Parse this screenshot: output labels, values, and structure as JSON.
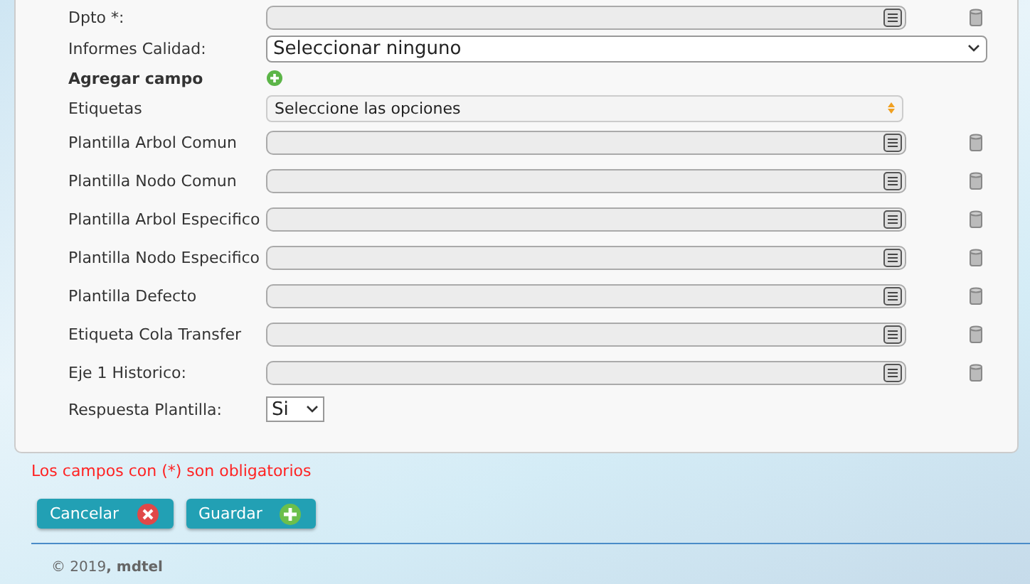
{
  "form": {
    "rows": [
      {
        "kind": "lookup",
        "label": "Dpto *:"
      },
      {
        "kind": "select",
        "label": "Informes Calidad:",
        "value": "Seleccionar ninguno"
      },
      {
        "kind": "add",
        "label": "Agregar campo"
      },
      {
        "kind": "multiselect",
        "label": "Etiquetas",
        "value": "Seleccione las opciones"
      },
      {
        "kind": "lookup",
        "label": "Plantilla Arbol Comun"
      },
      {
        "kind": "lookup",
        "label": "Plantilla Nodo Comun"
      },
      {
        "kind": "lookup",
        "label": "Plantilla Arbol Especifico"
      },
      {
        "kind": "lookup",
        "label": "Plantilla Nodo Especifico"
      },
      {
        "kind": "lookup",
        "label": "Plantilla Defecto"
      },
      {
        "kind": "lookup",
        "label": "Etiqueta Cola Transfer"
      },
      {
        "kind": "lookup",
        "label": "Eje 1 Historico:"
      },
      {
        "kind": "small_select",
        "label": "Respuesta Plantilla:",
        "value": "Si"
      }
    ]
  },
  "required_note": "Los campos con (*) son obligatorios",
  "buttons": [
    {
      "kind": "cancel",
      "label": "Cancelar"
    },
    {
      "kind": "save",
      "label": "Guardar"
    }
  ],
  "footer": "© 2019**, mdtel**"
}
